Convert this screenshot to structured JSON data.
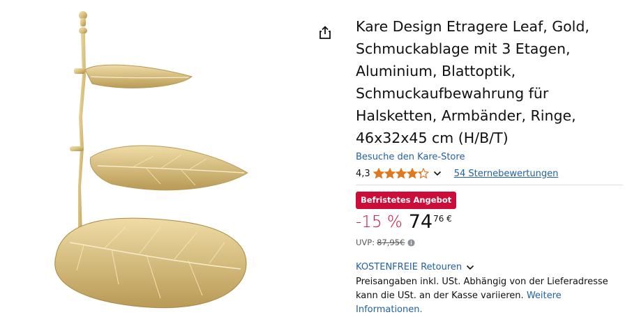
{
  "product": {
    "title": "Kare Design Etragere Leaf, Gold, Schmuckablage mit 3 Etagen, Aluminium, Blattoptik, Schmuckaufbewahrung für Halsketten, Armbänder, Ringe, 46x32x45 cm (H/B/T)",
    "store_link": "Besuche den Kare-Store",
    "image_icon": "gold-leaf-etagere-image"
  },
  "rating": {
    "value": "4,3",
    "stars": 4.3,
    "count_text": "54 Sternebewertungen"
  },
  "deal": {
    "badge": "Befristetes Angebot"
  },
  "price": {
    "discount": "-15 %",
    "whole": "74",
    "fraction": "76 €",
    "uvp_label": "UVP:",
    "uvp_value": "87,95€"
  },
  "returns": {
    "label": "KOSTENFREIE Retouren"
  },
  "tax": {
    "note": "Preisangaben inkl. USt. Abhängig von der Lieferadresse kann die USt. an der Kasse variieren.",
    "link": "Weitere Informationen."
  },
  "colors": {
    "link": "#2162a1",
    "deal": "#cc0c39",
    "star": "#de7921",
    "gold": "#d8bf7a"
  },
  "icons": [
    "share-icon",
    "star-icon",
    "chevron-down-icon",
    "info-icon"
  ]
}
